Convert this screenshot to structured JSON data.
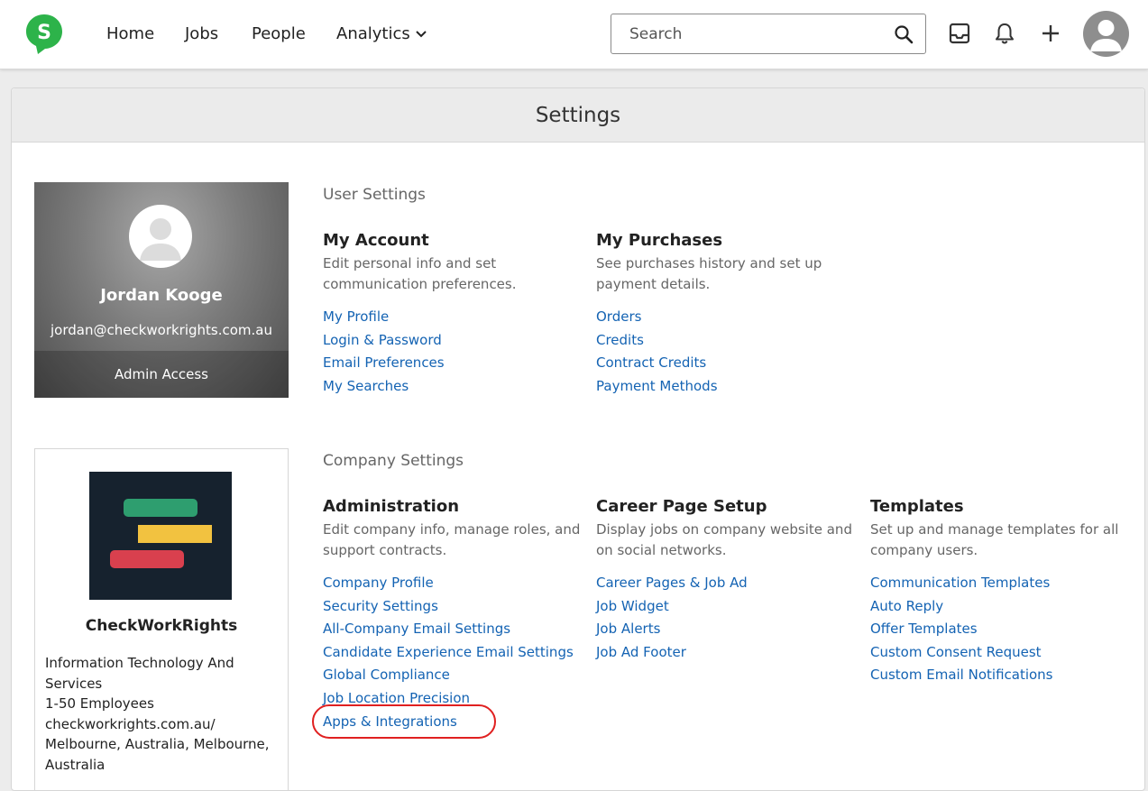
{
  "nav": {
    "home": "Home",
    "jobs": "Jobs",
    "people": "People",
    "analytics": "Analytics",
    "search_placeholder": "Search"
  },
  "icons": {
    "logo": "smartrecruiters-s-logo",
    "search": "search-icon",
    "inbox": "inbox-icon",
    "bell": "bell-icon",
    "plus": "plus-icon",
    "avatar": "user-avatar"
  },
  "colors": {
    "brand_green": "#2db34a",
    "link": "#1463b3",
    "highlight": "#e02020"
  },
  "page": {
    "title": "Settings"
  },
  "user": {
    "name": "Jordan Kooge",
    "email": "jordan@checkworkrights.com.au",
    "access": "Admin Access"
  },
  "company": {
    "name": "CheckWorkRights",
    "info": [
      "Information Technology And Services",
      "1-50 Employees",
      "checkworkrights.com.au/",
      "Melbourne, Australia, Melbourne, Australia"
    ]
  },
  "user_settings": {
    "title": "User Settings",
    "groups": [
      {
        "title": "My Account",
        "desc": "Edit personal info and set communication preferences.",
        "links": [
          "My Profile",
          "Login & Password",
          "Email Preferences",
          "My Searches"
        ]
      },
      {
        "title": "My Purchases",
        "desc": "See purchases history and set up payment details.",
        "links": [
          "Orders",
          "Credits",
          "Contract Credits",
          "Payment Methods"
        ]
      }
    ]
  },
  "company_settings": {
    "title": "Company Settings",
    "groups": [
      {
        "title": "Administration",
        "desc": "Edit company info, manage roles, and support contracts.",
        "links": [
          "Company Profile",
          "Security Settings",
          "All-Company Email Settings",
          "Candidate Experience Email Settings",
          "Global Compliance",
          "Job Location Precision",
          "Apps & Integrations"
        ]
      },
      {
        "title": "Career Page Setup",
        "desc": "Display jobs on company website and on social networks.",
        "links": [
          "Career Pages & Job Ad",
          "Job Widget",
          "Job Alerts",
          "Job Ad Footer"
        ]
      },
      {
        "title": "Templates",
        "desc": "Set up and manage templates for all company users.",
        "links": [
          "Communication Templates",
          "Auto Reply",
          "Offer Templates",
          "Custom Consent Request",
          "Custom Email Notifications"
        ]
      }
    ]
  }
}
